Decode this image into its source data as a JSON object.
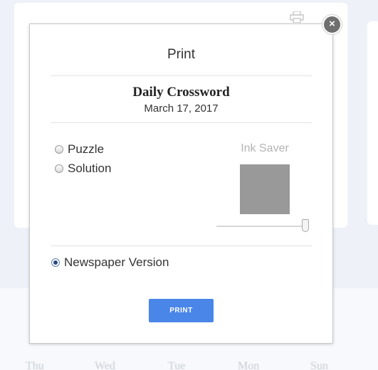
{
  "dialog": {
    "title": "Print",
    "close_label": "×",
    "puzzle_name": "Daily Crossword",
    "puzzle_date": "March 17, 2017",
    "options": [
      {
        "label": "Puzzle",
        "checked": false
      },
      {
        "label": "Solution",
        "checked": false
      }
    ],
    "ink_saver": {
      "label": "Ink Saver",
      "level": 1.0,
      "preview_color": "#999999"
    },
    "newspaper_version": {
      "label": "Newspaper Version",
      "checked": true
    },
    "print_button": "PRINT",
    "accent_color": "#4a86e8"
  },
  "background": {
    "day_labels": [
      "Thu",
      "Wed",
      "Tue",
      "Mon",
      "Sun"
    ]
  }
}
